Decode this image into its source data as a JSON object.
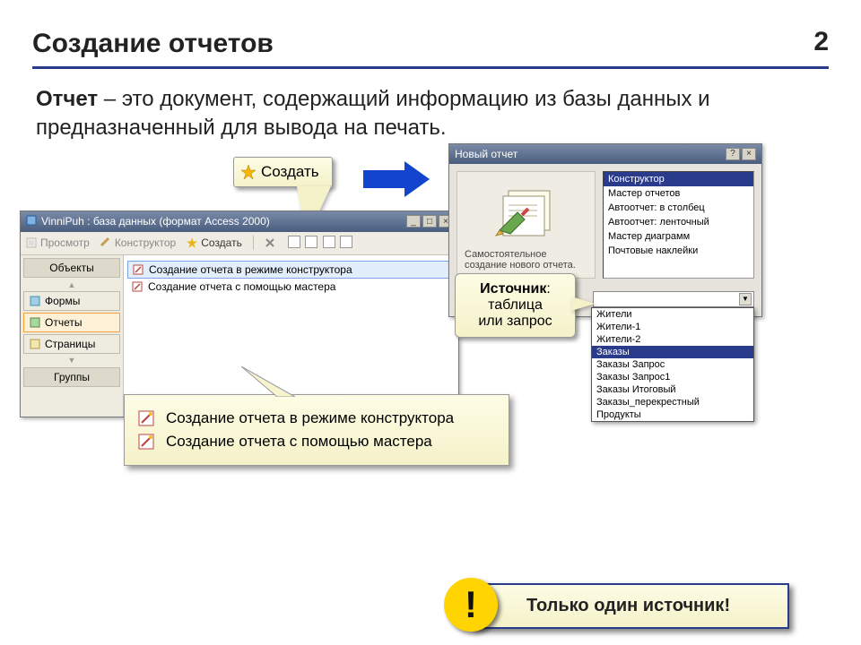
{
  "page_number": "2",
  "slide_title": "Создание отчетов",
  "definition": {
    "term": "Отчет",
    "rest": " – это документ, содержащий информацию из базы данных и предназначенный для вывода на печать."
  },
  "create_button": {
    "label": "Создать",
    "underline_char": "т"
  },
  "db_window": {
    "title": "VinniPuh : база данных (формат Access 2000)",
    "toolbar": {
      "preview": "Просмотр",
      "designer": "Конструктор",
      "create": "Создать"
    },
    "sidebar": {
      "header": "Объекты",
      "forms": "Формы",
      "reports": "Отчеты",
      "pages": "Страницы",
      "groups": "Группы"
    },
    "list": {
      "item1": "Создание отчета в режиме конструктора",
      "item2": "Создание отчета с помощью мастера"
    }
  },
  "options_callout": {
    "opt1": "Создание отчета в режиме конструктора",
    "opt2": "Создание отчета с помощью мастера"
  },
  "new_report_dialog": {
    "title": "Новый отчет",
    "left_caption": "Самостоятельное создание нового отчета.",
    "list": [
      "Конструктор",
      "Мастер отчетов",
      "Автоотчет: в столбец",
      "Автоотчет: ленточный",
      "Мастер диаграмм",
      "Почтовые наклейки"
    ],
    "selected_index": 0,
    "dropdown_items": [
      "Жители",
      "Жители-1",
      "Жители-2",
      "Заказы",
      "Заказы Запрос",
      "Заказы Запрос1",
      "Заказы Итоговый",
      "Заказы_перекрестный",
      "Продукты"
    ],
    "dropdown_selected_index": 3
  },
  "source_callout": {
    "strong": "Источник",
    "rest1": "таблица",
    "rest2": "или запрос"
  },
  "warning": {
    "exclaim": "!",
    "text": "Только один источник!"
  }
}
